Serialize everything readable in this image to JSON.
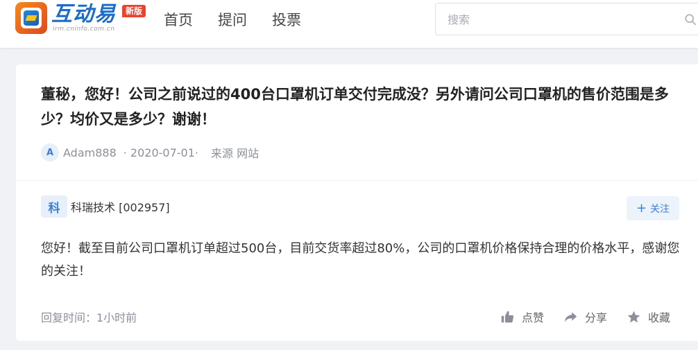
{
  "header": {
    "logo": {
      "text": "互动易",
      "sub": "irm.cninfo.com.cn",
      "badge": "新版"
    },
    "nav": [
      "首页",
      "提问",
      "投票"
    ],
    "search": {
      "placeholder": "搜索",
      "value": ""
    }
  },
  "question": {
    "title": "董秘，您好！公司之前说过的400台口罩机订单交付完成没？另外请问公司口罩机的售价范围是多少？均价又是多少？谢谢！",
    "avatar_letter": "A",
    "user": "Adam888",
    "date": "· 2020-07-01·",
    "source": "来源 网站"
  },
  "company": {
    "avatar_letter": "科",
    "name": "科瑞技术 [002957]",
    "follow_label": "关注"
  },
  "answer": {
    "text": "您好！截至目前公司口罩机订单超过500台，目前交货率超过80%，公司的口罩机价格保持合理的价格水平，感谢您的关注！",
    "reply_time": "回复时间：1小时前"
  },
  "actions": {
    "like": "点赞",
    "share": "分享",
    "favorite": "收藏"
  },
  "colors": {
    "accent": "#3d7fd6",
    "logo_blue": "#1c6cc9",
    "badge_red": "#e8432f",
    "icon_gray": "#8a8f99"
  }
}
